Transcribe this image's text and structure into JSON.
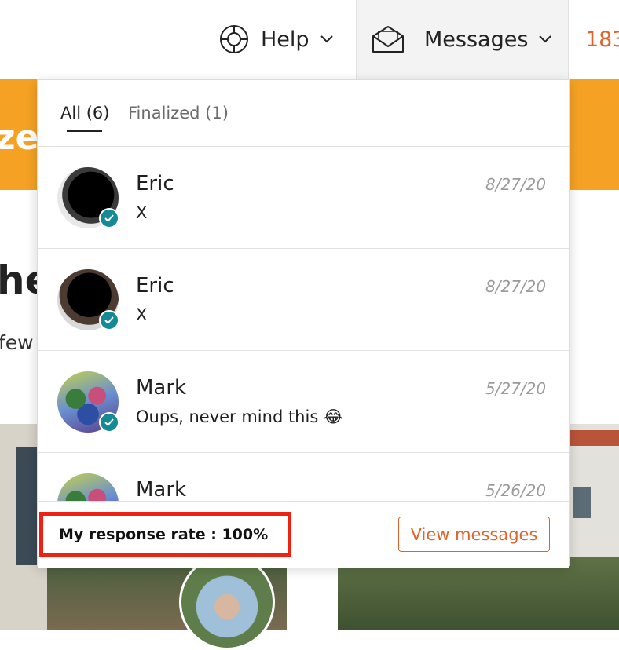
{
  "nav": {
    "help_label": "Help",
    "messages_label": "Messages",
    "count_text": "183"
  },
  "background": {
    "banner_fragment": "zed",
    "heading_fragment": "he",
    "subtext_fragment": "few"
  },
  "dropdown": {
    "tabs": [
      {
        "label": "All (6)",
        "active": true
      },
      {
        "label": "Finalized (1)",
        "active": false
      }
    ],
    "messages": [
      {
        "name": "Eric",
        "preview": "X",
        "date": "8/27/20",
        "verified": true
      },
      {
        "name": "Eric",
        "preview": "X",
        "date": "8/27/20",
        "verified": true
      },
      {
        "name": "Mark",
        "preview": "Oups, never mind this 😂",
        "date": "5/27/20",
        "verified": true
      },
      {
        "name": "Mark",
        "preview": "",
        "date": "5/26/20",
        "verified": true
      }
    ],
    "response_rate": "My response rate : 100%",
    "view_messages_label": "View messages"
  },
  "colors": {
    "accent": "#e0642b",
    "banner": "#f5a224",
    "verified_badge": "#148a96",
    "highlight_box": "#ee2112"
  },
  "icons": {
    "help": "lifebuoy-icon",
    "messages": "envelope-open-icon",
    "dropdown": "chevron-down-icon",
    "verified": "check-icon"
  }
}
